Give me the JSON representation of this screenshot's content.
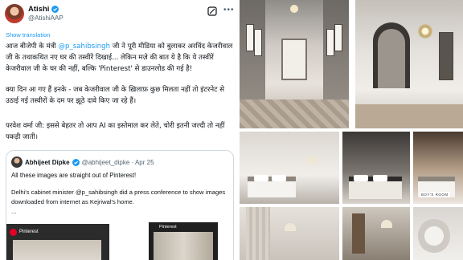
{
  "tweet": {
    "author_name": "Atishi",
    "author_handle": "@AtishiAAP",
    "show_translation": "Show translation",
    "para1_a": "आज बीजेपी के मंत्री ",
    "para1_mention": "@p_sahibsingh",
    "para1_b": " जी ने पूरी मीडिया को बुलाकर अरविंद केजरीवाल जी के तथाकथित नए घर की तस्वीरें दिखाई... लेकिन मज़े की बात ये है कि ये तस्वीरें केजरीवाल जी के घर की नहीं, बल्कि 'Pinterest' से डाउनलोड की गई है!",
    "para2": "क्या दिन आ गए हैं इनके - जब केजरीवाल जी के ख़िलाफ़ कुछ मिलता नहीं तो इंटरनेट से उठाई गई तस्वीरों के दम पर झूठे दावे किए जा रहे हैं।",
    "para3": "परवेश वर्मा जी: इससे बेहतर तो आप AI का इस्तेमाल कर लेते, चोरी इतनी जल्दी तो नहीं पकड़ी जाती।"
  },
  "quote": {
    "author_name": "Abhijeet Dipke",
    "author_handle": "@abhijeet_dipke · Apr 25",
    "line1": "All these images are straight out of Pinterest!",
    "line2": "Delhi's cabinet minister @p_sahibsingh did a press conference to show images downloaded from internet as Kejriwal's home.",
    "ellipsis": "...",
    "media1_label": "Pinterest",
    "media2_label": "Pinterest"
  },
  "collage": {
    "caption": "BOY'S ROOM"
  },
  "colors": {
    "link": "#1d9bf0",
    "secondary_text": "#536471",
    "pinterest_red": "#e60023"
  }
}
